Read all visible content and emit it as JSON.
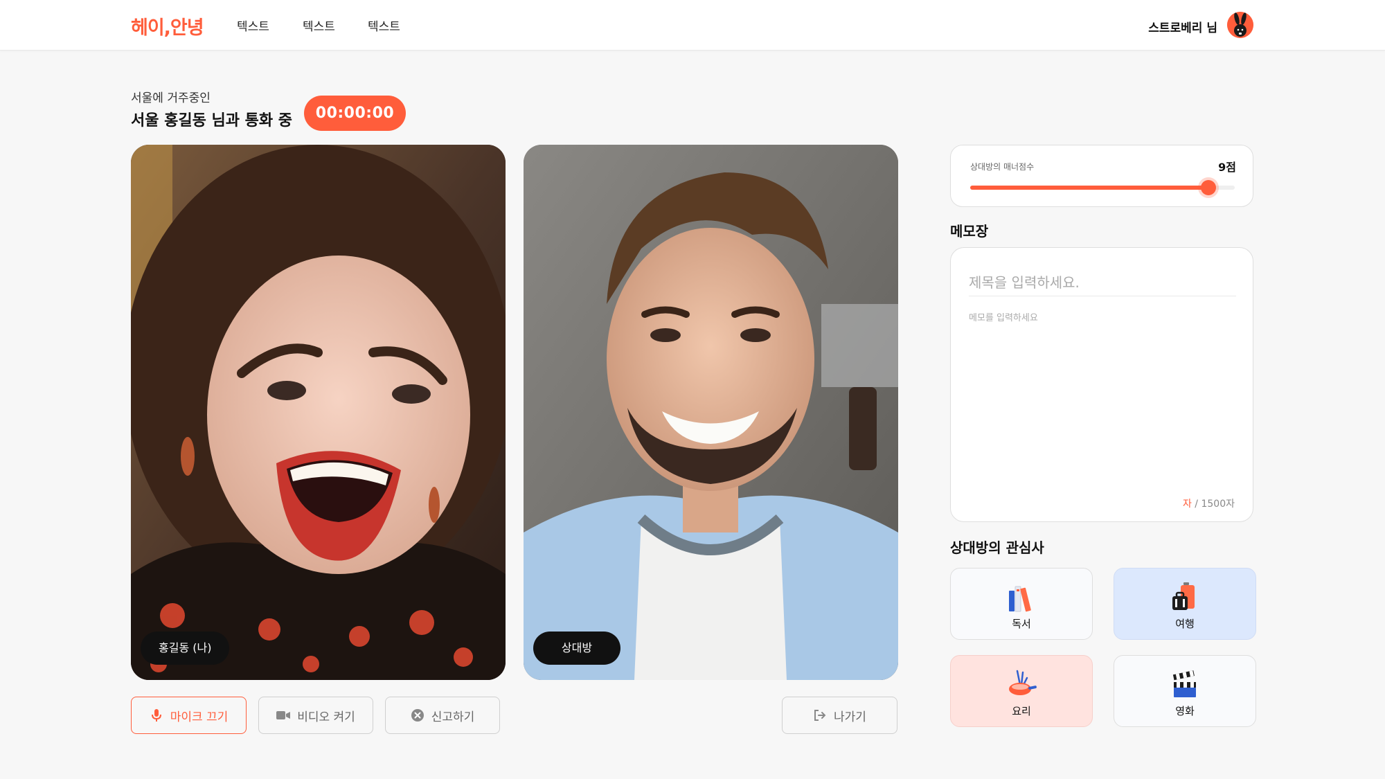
{
  "header": {
    "logo": "헤이,안녕",
    "nav": [
      "텍스트",
      "텍스트",
      "텍스트"
    ],
    "user_name": "스트로베리 님"
  },
  "call": {
    "location": "서울에 거주중인",
    "title": "서울 홍길동 님과 통화 중",
    "timer": "00:00:00"
  },
  "videos": {
    "me_label": "홍길동 (나)",
    "peer_label": "상대방"
  },
  "controls": {
    "mic": "마이크 끄기",
    "video": "비디오 켜기",
    "report": "신고하기",
    "leave": "나가기"
  },
  "score": {
    "label": "상대방의 매너점수",
    "value": "9점",
    "level_percent": 90
  },
  "memo": {
    "heading": "메모장",
    "title_placeholder": "제목을 입력하세요.",
    "body_placeholder": "메모를 입력하세요",
    "count_current": "자",
    "count_max": " / 1500자"
  },
  "interests": {
    "heading": "상대방의 관심사",
    "items": [
      {
        "label": "독서",
        "icon": "books-icon"
      },
      {
        "label": "여행",
        "icon": "luggage-icon"
      },
      {
        "label": "요리",
        "icon": "cooking-icon"
      },
      {
        "label": "영화",
        "icon": "clapperboard-icon"
      }
    ]
  },
  "colors": {
    "accent": "#ff5d3b",
    "travel_bg": "#dce8fd",
    "cooking_bg": "#ffe3df"
  }
}
